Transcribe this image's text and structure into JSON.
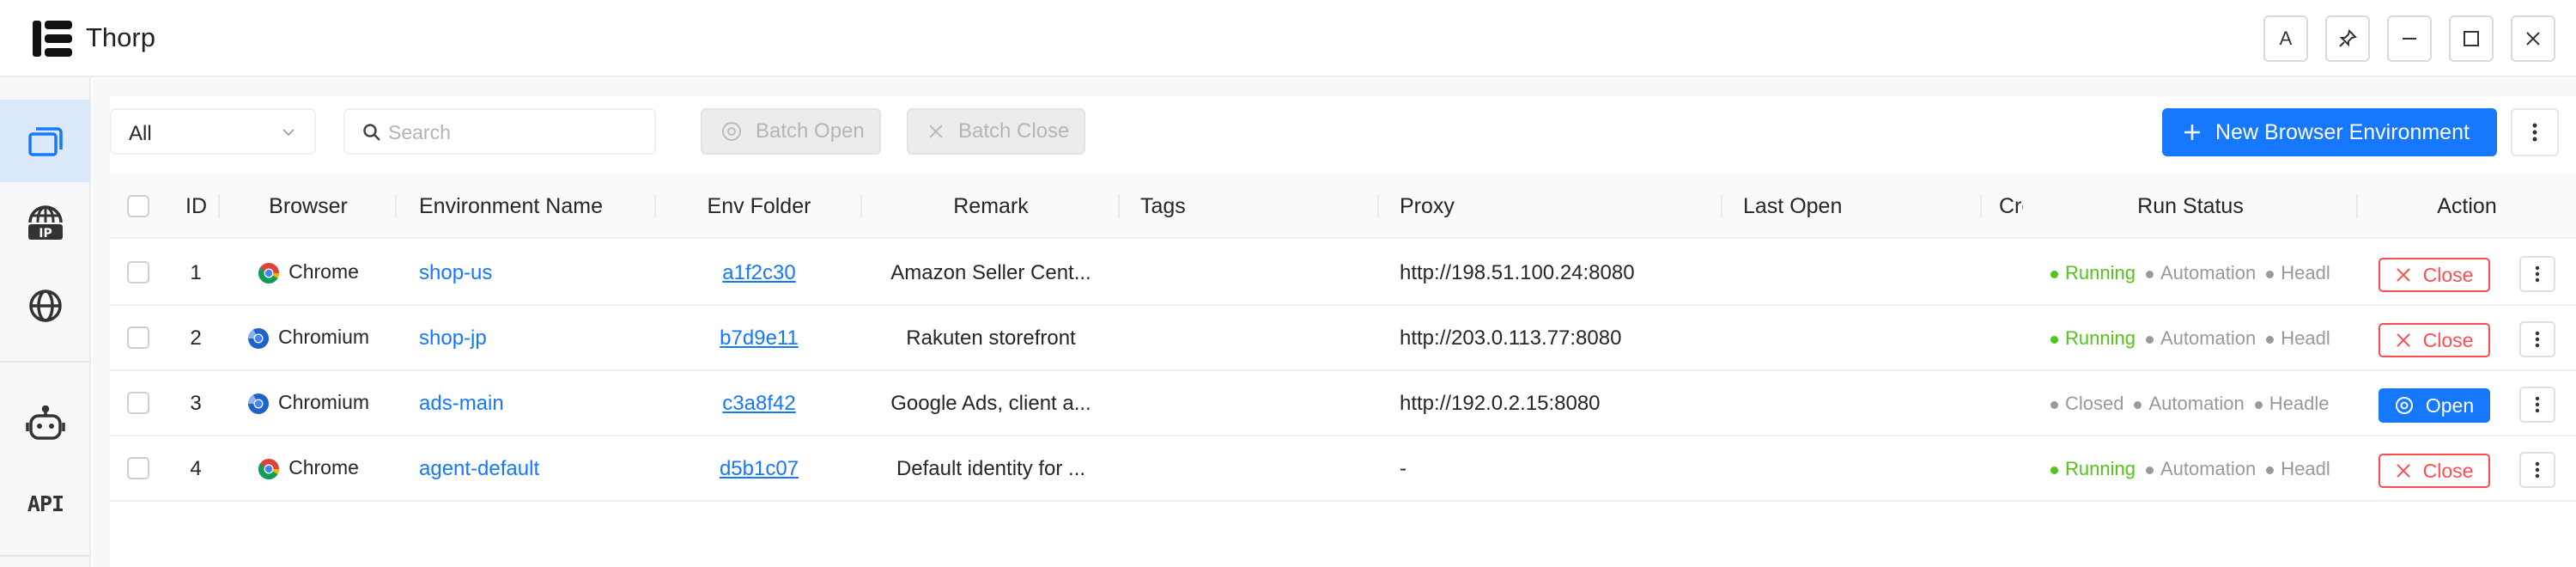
{
  "app": {
    "title": "Thorp"
  },
  "titlebar": {
    "buttons": [
      {
        "name": "font-a-button",
        "label": "A"
      },
      {
        "name": "pin-button",
        "icon": "pin-icon"
      },
      {
        "name": "minimize-button",
        "icon": "minimize-icon"
      },
      {
        "name": "maximize-button",
        "icon": "maximize-icon"
      },
      {
        "name": "close-window-button",
        "icon": "close-icon"
      }
    ]
  },
  "sidebar": {
    "items": [
      {
        "icon": "browser-windows-icon",
        "active": true
      },
      {
        "icon": "ip-globe-icon"
      },
      {
        "icon": "globe-icon"
      },
      {
        "icon": "robot-icon"
      },
      {
        "label": "API"
      }
    ]
  },
  "toolbar": {
    "filter_value": "All",
    "search_placeholder": "Search",
    "batch_open": "Batch Open",
    "batch_close": "Batch Close",
    "new_env": "New Browser Environment"
  },
  "table": {
    "headers": {
      "id": "ID",
      "browser": "Browser",
      "env_name": "Environment Name",
      "folder": "Env Folder",
      "remark": "Remark",
      "tags": "Tags",
      "proxy": "Proxy",
      "last_open": "Last Open",
      "created": "Crea",
      "run_status": "Run Status",
      "action": "Action"
    },
    "rows": [
      {
        "id": "1",
        "browser": "Chrome",
        "browser_icon": "chrome-icon",
        "name": "shop-us",
        "folder": "a1f2c30",
        "remark": "Amazon Seller Cent...",
        "tags": "",
        "proxy": "http://198.51.100.24:8080",
        "last_open": "",
        "status": "Running",
        "automation": "Automation",
        "headless": "Headl",
        "action": "Close"
      },
      {
        "id": "2",
        "browser": "Chromium",
        "browser_icon": "chromium-icon",
        "name": "shop-jp",
        "folder": "b7d9e11",
        "remark": "Rakuten storefront",
        "tags": "",
        "proxy": "http://203.0.113.77:8080",
        "last_open": "",
        "status": "Running",
        "automation": "Automation",
        "headless": "Headl",
        "action": "Close"
      },
      {
        "id": "3",
        "browser": "Chromium",
        "browser_icon": "chromium-icon",
        "name": "ads-main",
        "folder": "c3a8f42",
        "remark": "Google Ads, client a...",
        "tags": "",
        "proxy": "http://192.0.2.15:8080",
        "last_open": "",
        "status": "Closed",
        "automation": "Automation",
        "headless": "Headle",
        "action": "Open"
      },
      {
        "id": "4",
        "browser": "Chrome",
        "browser_icon": "chrome-icon",
        "name": "agent-default",
        "folder": "d5b1c07",
        "remark": "Default identity for ...",
        "tags": "",
        "proxy": "-",
        "last_open": "",
        "status": "Running",
        "automation": "Automation",
        "headless": "Headl",
        "action": "Close"
      }
    ]
  },
  "colors": {
    "primary": "#1677ff",
    "running": "#52c41a",
    "danger": "#ff4d4f",
    "muted": "#999999"
  }
}
